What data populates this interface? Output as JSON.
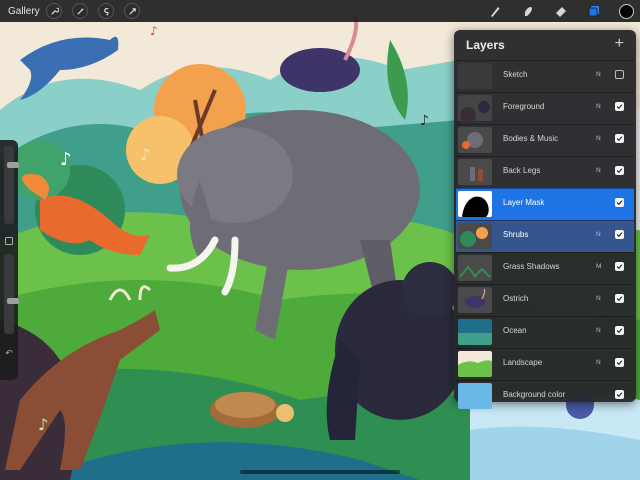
{
  "app": {
    "gallery_label": "Gallery"
  },
  "toolbar": {
    "left_tools": [
      "wrench-icon",
      "magic-wand-icon",
      "selection-icon",
      "transform-icon"
    ],
    "right_tools": [
      "brush-icon",
      "smudge-icon",
      "eraser-icon",
      "layers-icon"
    ],
    "active_tool": "layers-icon",
    "current_color": "#050505"
  },
  "sidebar": {
    "brush_size_level": 0.2,
    "opacity_level": 0.55
  },
  "layers_panel": {
    "title": "Layers",
    "add_symbol": "+",
    "layers": [
      {
        "name": "Sketch",
        "blend": "N",
        "visible": false,
        "state": "normal"
      },
      {
        "name": "Foreground",
        "blend": "N",
        "visible": true,
        "state": "normal"
      },
      {
        "name": "Bodies & Music",
        "blend": "N",
        "visible": true,
        "state": "normal"
      },
      {
        "name": "Back Legs",
        "blend": "N",
        "visible": true,
        "state": "normal"
      },
      {
        "name": "Layer Mask",
        "blend": "",
        "visible": true,
        "state": "active"
      },
      {
        "name": "Shrubs",
        "blend": "N",
        "visible": true,
        "state": "selected"
      },
      {
        "name": "Grass Shadows",
        "blend": "M",
        "visible": true,
        "state": "normal"
      },
      {
        "name": "Ostrich",
        "blend": "N",
        "visible": true,
        "state": "normal"
      },
      {
        "name": "Ocean",
        "blend": "N",
        "visible": true,
        "state": "normal"
      },
      {
        "name": "Landscape",
        "blend": "N",
        "visible": true,
        "state": "normal"
      },
      {
        "name": "Background color",
        "blend": "",
        "visible": true,
        "state": "normal"
      }
    ]
  },
  "colors": {
    "active_layer": "#1f74e3",
    "selected_layer": "#35558f",
    "panel_bg": "#28282c"
  }
}
